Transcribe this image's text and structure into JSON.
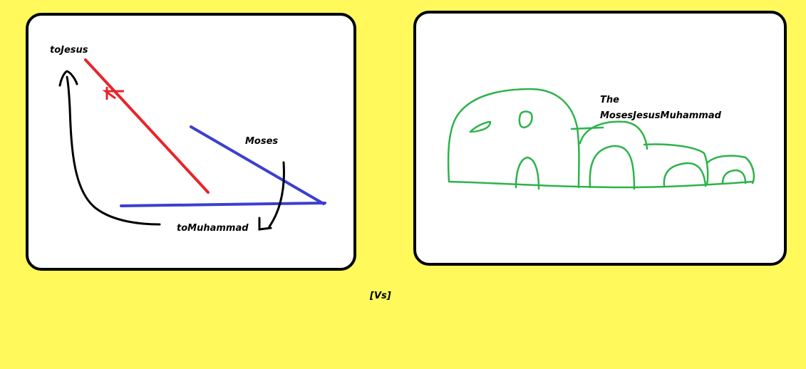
{
  "left_panel": {
    "label_to_jesus": "toJesus",
    "label_moses": "Moses",
    "label_to_muhammad": "toMuhammad"
  },
  "right_panel": {
    "label_line1": "The",
    "label_line2": "MosesJesusMuhammad"
  },
  "vs_label": "[Vs]",
  "colors": {
    "background": "#fff95c",
    "red_stroke": "#e8242b",
    "blue_stroke": "#3b3fcf",
    "black_stroke": "#000000",
    "green_stroke": "#2db34a"
  }
}
